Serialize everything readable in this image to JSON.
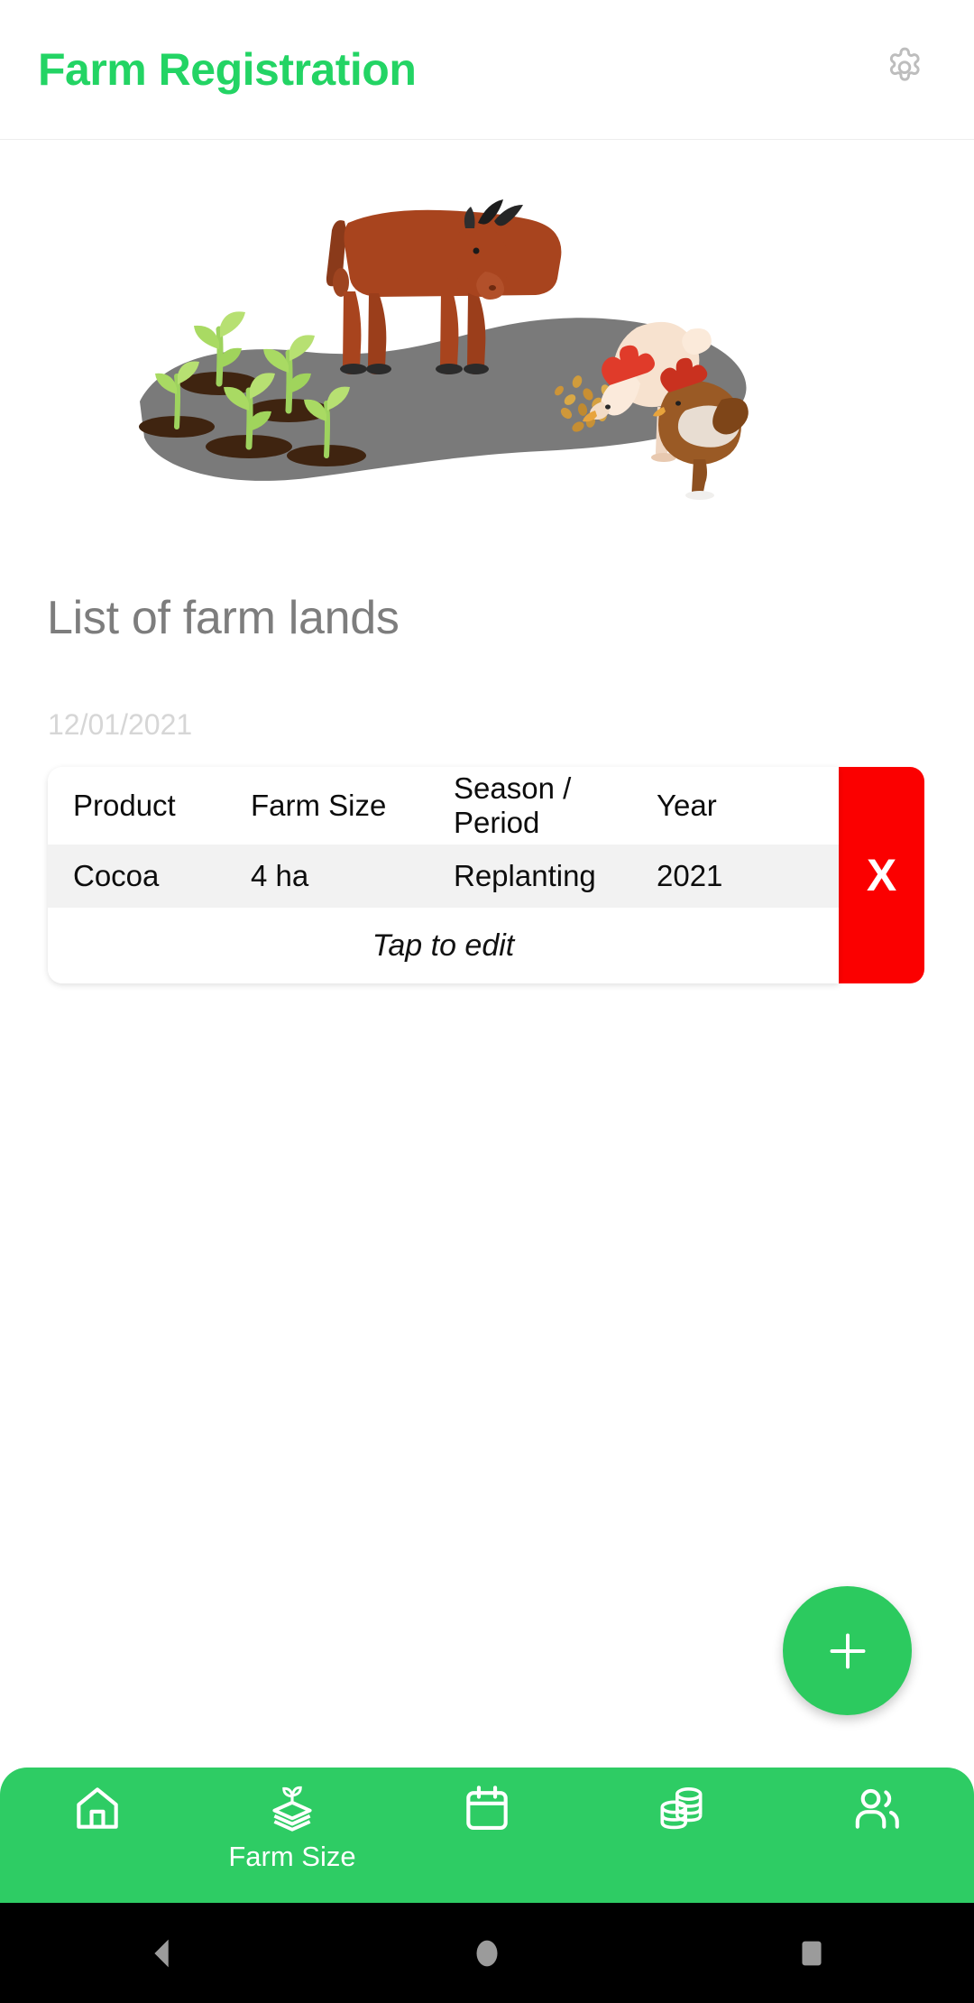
{
  "appbar": {
    "title": "Farm Registration",
    "settings_icon": "gear-icon",
    "title_color": "#23d464"
  },
  "hero": {
    "illustration": "farm-field-illustration",
    "elements": [
      "cow",
      "chicken-white",
      "chicken-brown",
      "seedlings",
      "soil-mounds",
      "scattered-seeds"
    ],
    "field_color": "#7a7a7a",
    "cow_color": "#a8441e",
    "sprout_color": "#a4d75c",
    "soil_color": "#4a2a15"
  },
  "section": {
    "title": "List of farm lands",
    "date": "12/01/2021"
  },
  "table": {
    "headers": [
      "Product",
      "Farm Size",
      "Season / Period",
      "Year"
    ],
    "rows": [
      {
        "product": "Cocoa",
        "farm_size": "4 ha",
        "season": "Replanting",
        "year": "2021"
      }
    ],
    "tap_hint": "Tap to edit",
    "delete_label": "X",
    "delete_color": "#fb0000"
  },
  "fab": {
    "icon": "plus-icon",
    "color": "#2cca5f"
  },
  "bottomnav": {
    "background": "#2ecc64",
    "items": [
      {
        "icon": "home-icon",
        "label": ""
      },
      {
        "icon": "farm-layers-sprout-icon",
        "label": "Farm Size"
      },
      {
        "icon": "calendar-icon",
        "label": ""
      },
      {
        "icon": "coins-icon",
        "label": ""
      },
      {
        "icon": "users-icon",
        "label": ""
      }
    ]
  },
  "systembar": {
    "back": "back-triangle-icon",
    "home": "home-circle-icon",
    "recents": "recents-square-icon"
  }
}
